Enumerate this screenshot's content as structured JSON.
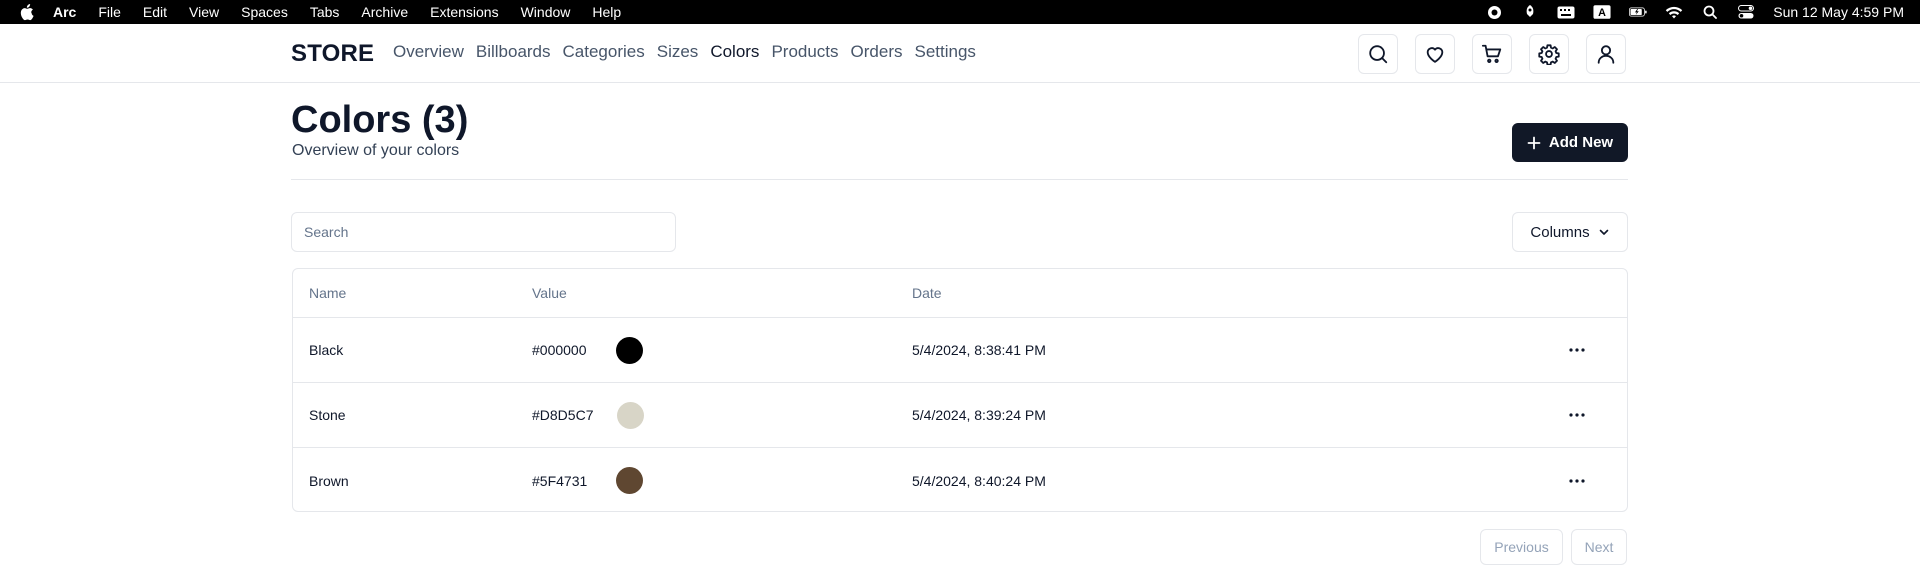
{
  "menubar": {
    "app_name": "Arc",
    "menus": [
      "File",
      "Edit",
      "View",
      "Spaces",
      "Tabs",
      "Archive",
      "Extensions",
      "Window",
      "Help"
    ],
    "keyboard_indicator": "A",
    "clock": "Sun 12 May  4:59 PM"
  },
  "header": {
    "brand": "STORE",
    "nav": [
      {
        "label": "Overview",
        "active": false
      },
      {
        "label": "Billboards",
        "active": false
      },
      {
        "label": "Categories",
        "active": false
      },
      {
        "label": "Sizes",
        "active": false
      },
      {
        "label": "Colors",
        "active": true
      },
      {
        "label": "Products",
        "active": false
      },
      {
        "label": "Orders",
        "active": false
      },
      {
        "label": "Settings",
        "active": false
      }
    ],
    "icons": [
      "search-icon",
      "heart-icon",
      "cart-icon",
      "gear-icon",
      "user-icon"
    ]
  },
  "page": {
    "title": "Colors (3)",
    "subtitle": "Overview of your colors",
    "add_button": "Add New"
  },
  "toolbar": {
    "search_placeholder": "Search",
    "search_value": "",
    "columns_button": "Columns"
  },
  "table": {
    "columns": [
      "Name",
      "Value",
      "Date"
    ],
    "rows": [
      {
        "name": "Black",
        "value": "#000000",
        "swatch": "#000000",
        "date": "5/4/2024, 8:38:41 PM"
      },
      {
        "name": "Stone",
        "value": "#D8D5C7",
        "swatch": "#D8D5C7",
        "date": "5/4/2024, 8:39:24 PM"
      },
      {
        "name": "Brown",
        "value": "#5F4731",
        "swatch": "#5F4731",
        "date": "5/4/2024, 8:40:24 PM"
      }
    ]
  },
  "pagination": {
    "previous": "Previous",
    "next": "Next"
  },
  "colors": {
    "primary_button": "#111827",
    "border": "#e5e7eb",
    "muted_text": "#64748b"
  }
}
